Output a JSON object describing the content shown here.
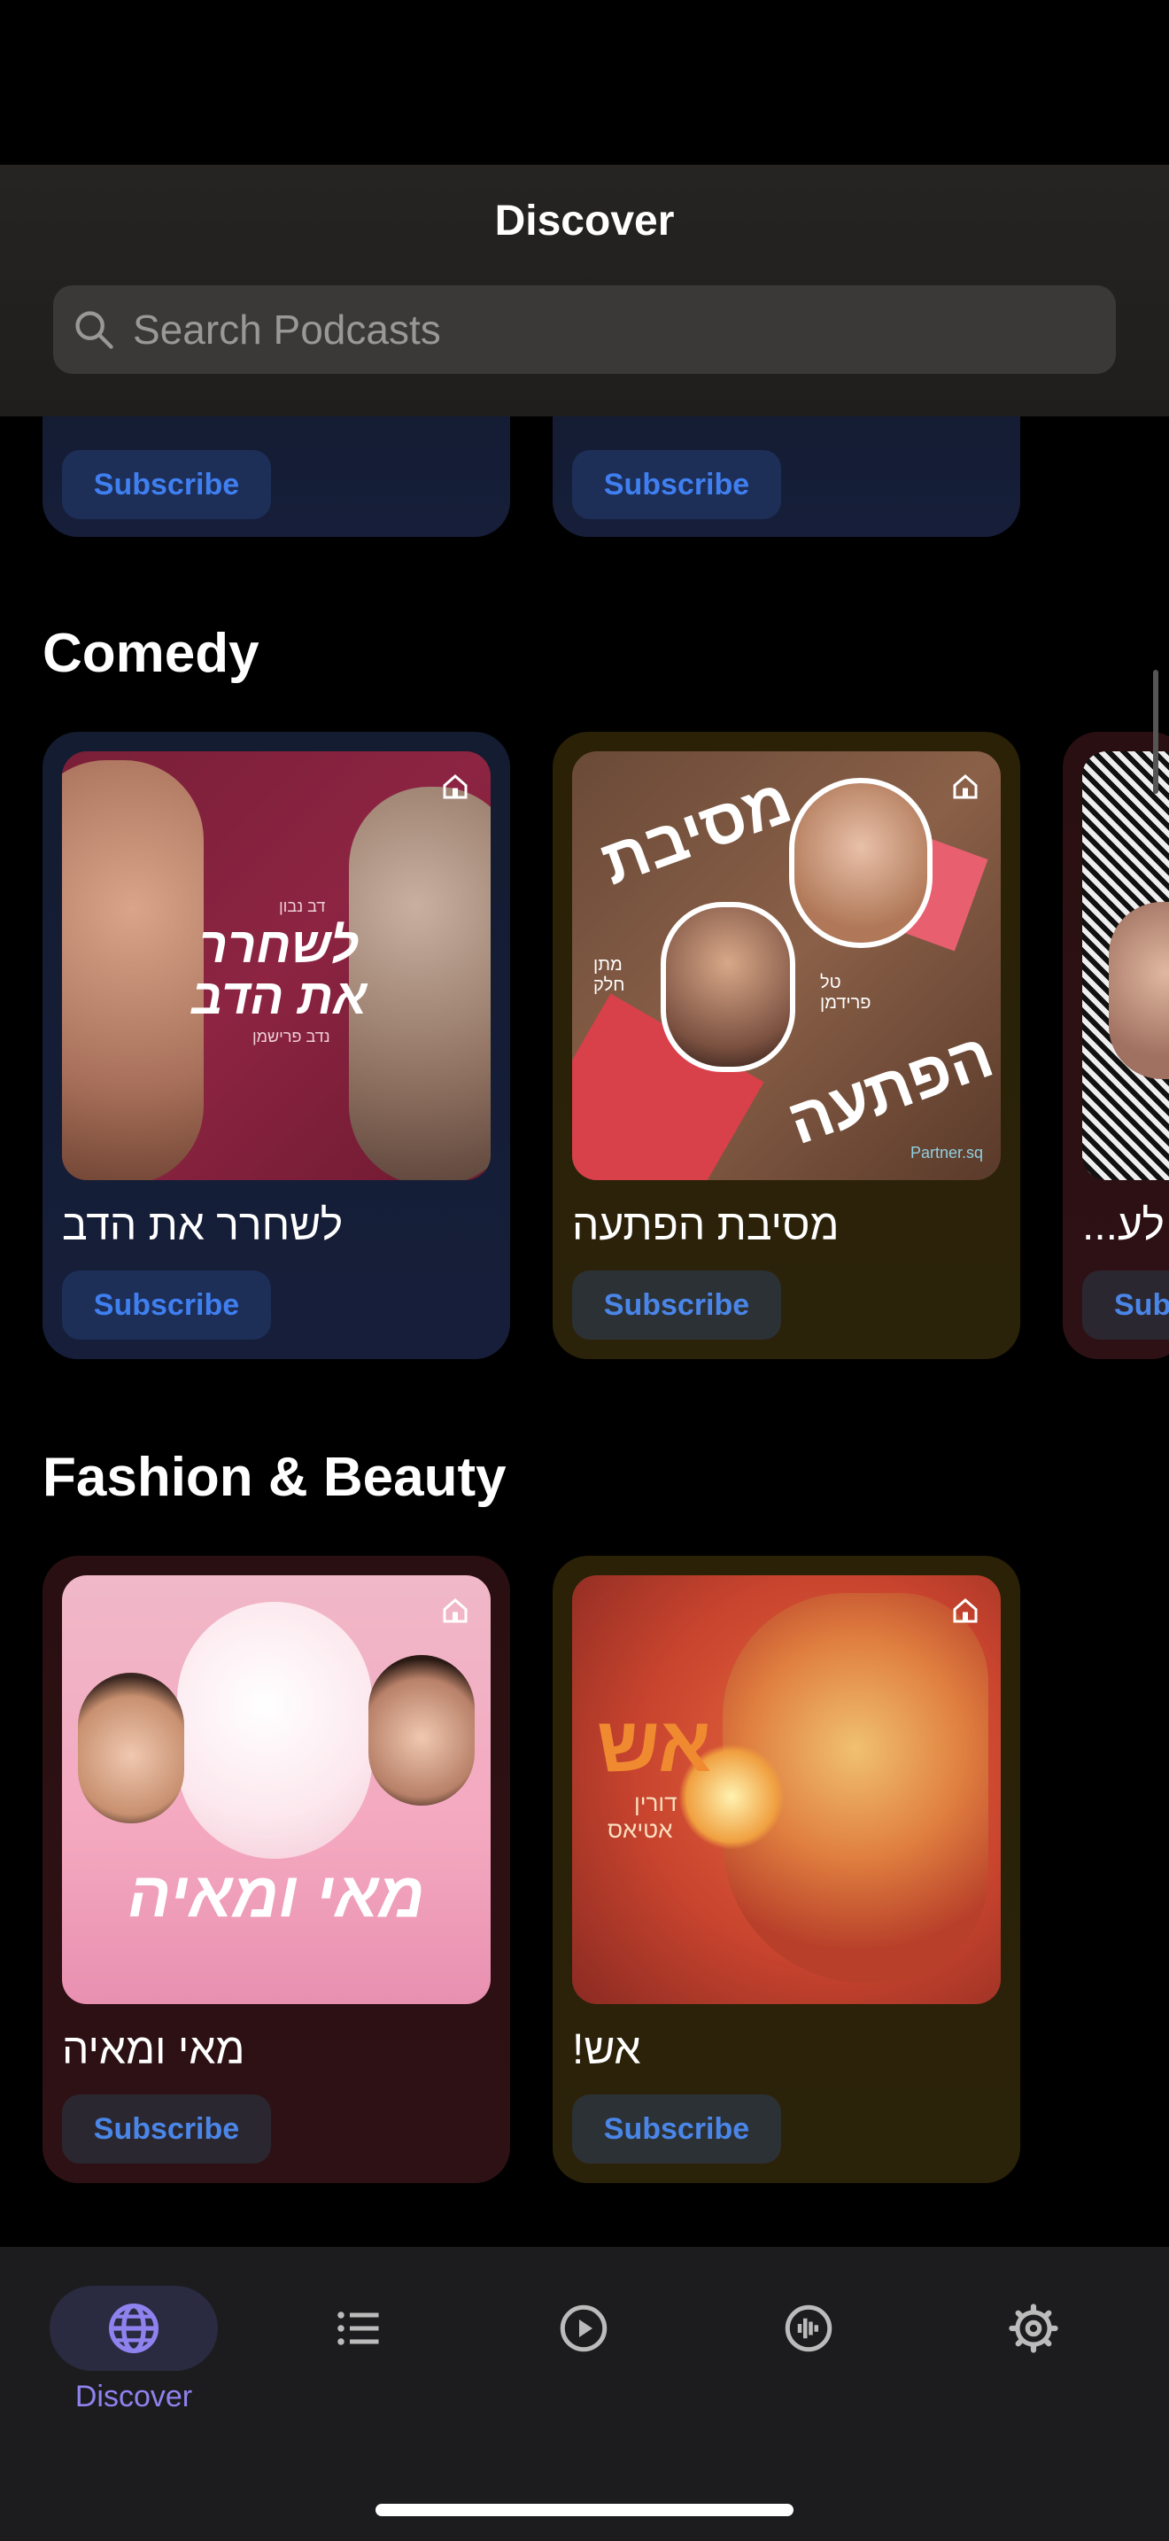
{
  "header": {
    "title": "Discover",
    "search_placeholder": "Search Podcasts"
  },
  "top_row": {
    "subscribe_label": "Subscribe"
  },
  "sections": [
    {
      "title": "Comedy",
      "podcasts": [
        {
          "title": "לשחרר את הדב",
          "art_text": "לשחרר את הדב",
          "art_sub1": "דב נבון",
          "art_sub2": "נדב פרישמן",
          "subscribe": "Subscribe"
        },
        {
          "title": "מסיבת הפתעה",
          "art_text1": "מסיבת",
          "art_text2": "הפתעה",
          "art_sub1": "מתן חלק",
          "art_sub2": "טל פרידמן",
          "art_brand": "Partner.sq",
          "subscribe": "Subscribe"
        },
        {
          "title": "...לע",
          "subscribe": "Sub"
        }
      ]
    },
    {
      "title": "Fashion & Beauty",
      "podcasts": [
        {
          "title": "מאי ומאיה",
          "art_text": "מאי ומאיה",
          "subscribe": "Subscribe"
        },
        {
          "title": "אש!",
          "art_text": "אש",
          "art_sub1": "דורין",
          "art_sub2": "אטיאס",
          "subscribe": "Subscribe"
        }
      ]
    }
  ],
  "tabbar": {
    "items": [
      {
        "label": "Discover",
        "icon": "globe-icon",
        "active": true
      },
      {
        "label": "",
        "icon": "list-icon"
      },
      {
        "label": "",
        "icon": "play-circle-icon"
      },
      {
        "label": "",
        "icon": "waveform-icon"
      },
      {
        "label": "",
        "icon": "gear-icon"
      }
    ]
  },
  "colors": {
    "accent": "#3f7ff0",
    "tab_active": "#8e82ee"
  }
}
